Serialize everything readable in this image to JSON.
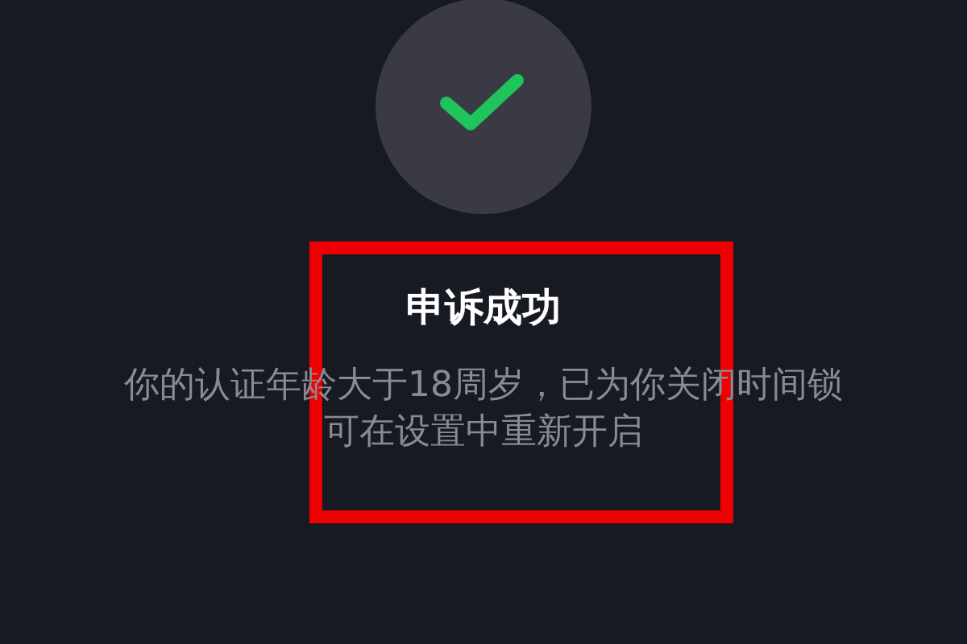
{
  "title": "申诉成功",
  "message_lines": [
    "你的认证年龄大于18周岁，已为你关闭时间锁",
    "可在设置中重新开启"
  ]
}
